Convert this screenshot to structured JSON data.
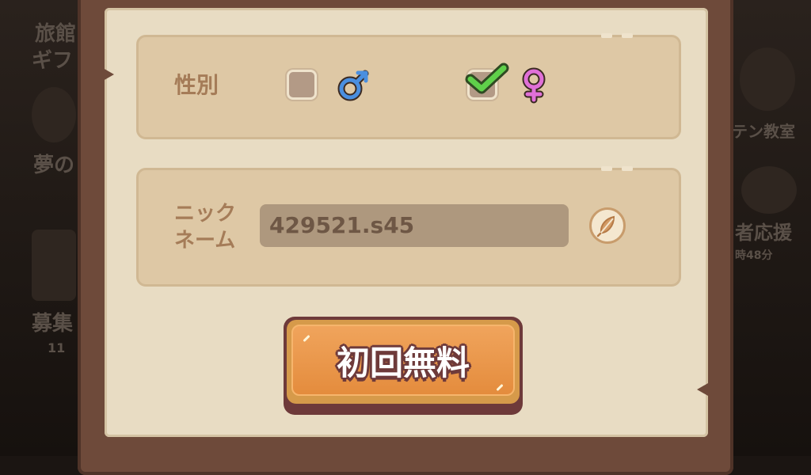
{
  "gender": {
    "label": "性別",
    "male": {
      "checked": false,
      "icon": "male-symbol-icon",
      "color": "#4a8fe0"
    },
    "female": {
      "checked": true,
      "icon": "female-symbol-icon",
      "color": "#e070d8"
    }
  },
  "nickname": {
    "label_line1": "ニック",
    "label_line2": "ネーム",
    "value": "429521.s45",
    "edit_icon": "feather-icon"
  },
  "free_button": {
    "label": "初回無料"
  },
  "background": {
    "left_texts": [
      "旅館",
      "ギフ",
      "夢の",
      "募集"
    ],
    "left_count": "11",
    "right_texts": [
      "テン教室",
      "者応援"
    ],
    "right_timer": "時48分"
  },
  "colors": {
    "panel": "#e8dcc3",
    "card": "#dec8a5",
    "label": "#a57c58",
    "frame": "#6e4a3a",
    "button": "#e48c3d"
  }
}
